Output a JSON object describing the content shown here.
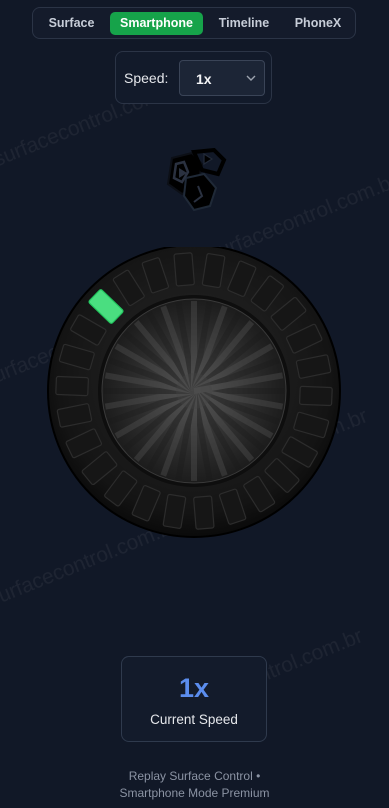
{
  "tabs": [
    {
      "label": "Surface",
      "active": false
    },
    {
      "label": "Smartphone",
      "active": true
    },
    {
      "label": "Timeline",
      "active": false
    },
    {
      "label": "PhoneX",
      "active": false
    }
  ],
  "speed": {
    "label": "Speed:",
    "selected": "1x"
  },
  "knob": {
    "segments_total": 26,
    "active_segment": 1
  },
  "display": {
    "value": "1x",
    "caption": "Current Speed"
  },
  "footer": {
    "line1": "Replay Surface Control •",
    "line2": "Smartphone Mode Premium"
  },
  "watermark": "surfacecontrol.com.br",
  "colors": {
    "accent_green": "#16a34a",
    "led_green": "#4ade80",
    "speed_blue": "#5b8dee",
    "background": "#111827"
  }
}
